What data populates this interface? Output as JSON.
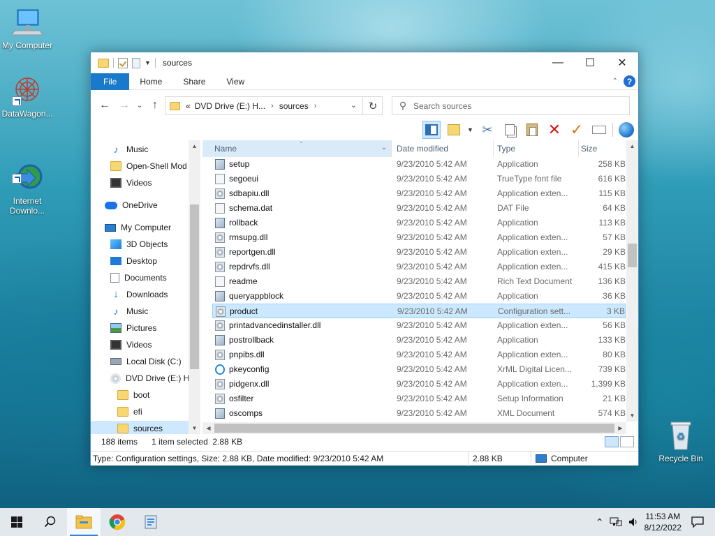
{
  "desktop": {
    "icons": [
      {
        "label": "My Computer"
      },
      {
        "label": "DataWagon..."
      },
      {
        "label": "Internet\nDownlo..."
      },
      {
        "label": "Recycle Bin"
      }
    ]
  },
  "window": {
    "title": "sources",
    "ribbon_tabs": [
      "File",
      "Home",
      "Share",
      "View"
    ],
    "address": {
      "prefix": "«",
      "crumbs": [
        "DVD Drive (E:) H...",
        "sources"
      ]
    },
    "search": {
      "placeholder": "Search sources"
    },
    "nav_pane": [
      {
        "label": "Music",
        "icon": "music-icon"
      },
      {
        "label": "Open-Shell Mod",
        "icon": "folder-icon"
      },
      {
        "label": "Videos",
        "icon": "video-icon"
      },
      {
        "label": "OneDrive",
        "icon": "cloud-icon"
      },
      {
        "label": "My Computer",
        "icon": "computer-icon"
      },
      {
        "label": "3D Objects",
        "icon": "3d-objects-icon"
      },
      {
        "label": "Desktop",
        "icon": "desktop-icon"
      },
      {
        "label": "Documents",
        "icon": "documents-icon"
      },
      {
        "label": "Downloads",
        "icon": "downloads-icon"
      },
      {
        "label": "Music",
        "icon": "music-icon"
      },
      {
        "label": "Pictures",
        "icon": "pictures-icon"
      },
      {
        "label": "Videos",
        "icon": "video-icon"
      },
      {
        "label": "Local Disk (C:)",
        "icon": "disk-icon"
      },
      {
        "label": "DVD Drive (E:) H",
        "icon": "dvd-icon"
      },
      {
        "label": "boot",
        "icon": "folder-icon"
      },
      {
        "label": "efi",
        "icon": "folder-icon"
      },
      {
        "label": "sources",
        "icon": "folder-icon"
      }
    ],
    "columns": [
      "Name",
      "Date modified",
      "Type",
      "Size"
    ],
    "files": [
      {
        "name": "setup",
        "date": "9/23/2010 5:42 AM",
        "type": "Application",
        "size": "258 KB",
        "icon": "app"
      },
      {
        "name": "segoeui",
        "date": "9/23/2010 5:42 AM",
        "type": "TrueType font file",
        "size": "616 KB",
        "icon": "font"
      },
      {
        "name": "sdbapiu.dll",
        "date": "9/23/2010 5:42 AM",
        "type": "Application exten...",
        "size": "115 KB",
        "icon": "gear"
      },
      {
        "name": "schema.dat",
        "date": "9/23/2010 5:42 AM",
        "type": "DAT File",
        "size": "64 KB",
        "icon": "file"
      },
      {
        "name": "rollback",
        "date": "9/23/2010 5:42 AM",
        "type": "Application",
        "size": "113 KB",
        "icon": "app"
      },
      {
        "name": "rmsupg.dll",
        "date": "9/23/2010 5:42 AM",
        "type": "Application exten...",
        "size": "57 KB",
        "icon": "gear"
      },
      {
        "name": "reportgen.dll",
        "date": "9/23/2010 5:42 AM",
        "type": "Application exten...",
        "size": "29 KB",
        "icon": "gear"
      },
      {
        "name": "repdrvfs.dll",
        "date": "9/23/2010 5:42 AM",
        "type": "Application exten...",
        "size": "415 KB",
        "icon": "gear"
      },
      {
        "name": "readme",
        "date": "9/23/2010 5:42 AM",
        "type": "Rich Text Document",
        "size": "136 KB",
        "icon": "file"
      },
      {
        "name": "queryappblock",
        "date": "9/23/2010 5:42 AM",
        "type": "Application",
        "size": "36 KB",
        "icon": "app"
      },
      {
        "name": "product",
        "date": "9/23/2010 5:42 AM",
        "type": "Configuration sett...",
        "size": "3 KB",
        "icon": "gear"
      },
      {
        "name": "printadvancedinstaller.dll",
        "date": "9/23/2010 5:42 AM",
        "type": "Application exten...",
        "size": "56 KB",
        "icon": "gear"
      },
      {
        "name": "postrollback",
        "date": "9/23/2010 5:42 AM",
        "type": "Application",
        "size": "133 KB",
        "icon": "app"
      },
      {
        "name": "pnpibs.dll",
        "date": "9/23/2010 5:42 AM",
        "type": "Application exten...",
        "size": "80 KB",
        "icon": "gear"
      },
      {
        "name": "pkeyconfig",
        "date": "9/23/2010 5:42 AM",
        "type": "XrML Digital Licen...",
        "size": "739 KB",
        "icon": "ie"
      },
      {
        "name": "pidgenx.dll",
        "date": "9/23/2010 5:42 AM",
        "type": "Application exten...",
        "size": "1,399 KB",
        "icon": "gear"
      },
      {
        "name": "osfilter",
        "date": "9/23/2010 5:42 AM",
        "type": "Setup Information",
        "size": "21 KB",
        "icon": "gear"
      },
      {
        "name": "oscomps",
        "date": "9/23/2010 5:42 AM",
        "type": "XML Document",
        "size": "574 KB",
        "icon": "app"
      }
    ],
    "status": {
      "items": "188 items",
      "selected": "1 item selected  2.88 KB",
      "details": "Type: Configuration settings, Size: 2.88 KB, Date modified: 9/23/2010 5:42 AM",
      "size": "2.88 KB",
      "location": "Computer"
    }
  },
  "taskbar": {
    "time": "11:53 AM",
    "date": "8/12/2022"
  }
}
